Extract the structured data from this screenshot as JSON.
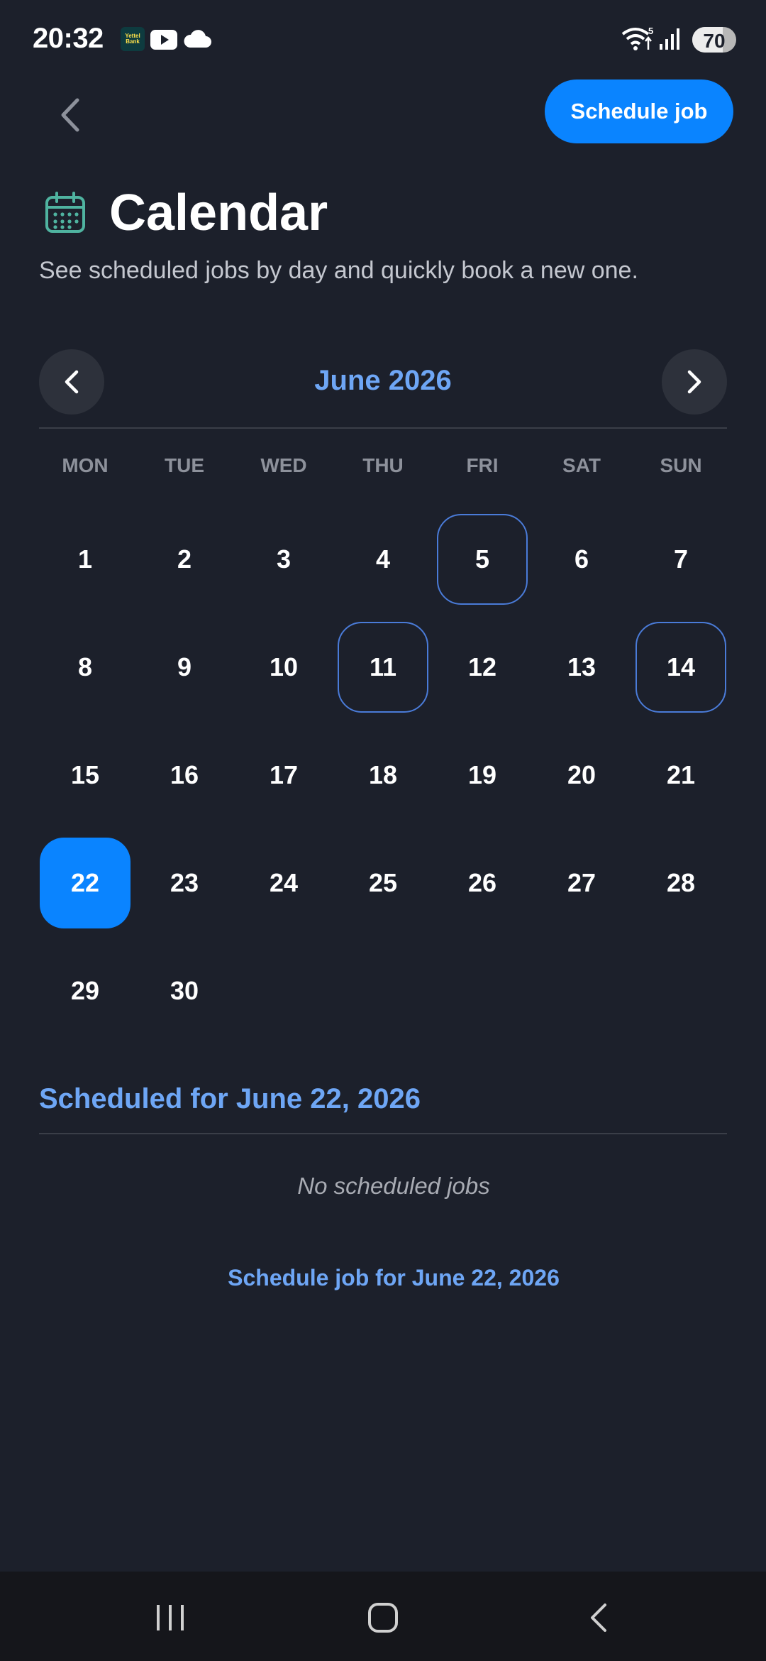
{
  "status_bar": {
    "time": "20:32",
    "bank_badge": "Yettel Bank",
    "wifi_badge": "5",
    "battery_level": "70",
    "icons": [
      "bank-app-icon",
      "youtube-icon",
      "cloud-icon",
      "wifi-icon",
      "signal-icon",
      "battery-icon"
    ]
  },
  "header": {
    "back_icon": "chevron-left-icon",
    "schedule_button": "Schedule job"
  },
  "page": {
    "title": "Calendar",
    "title_icon": "calendar-icon",
    "subtitle": "See scheduled jobs by day and quickly book a new one."
  },
  "month_nav": {
    "label": "June 2026",
    "prev_icon": "chevron-left-icon",
    "next_icon": "chevron-right-icon"
  },
  "calendar": {
    "weekdays": [
      "MON",
      "TUE",
      "WED",
      "THU",
      "FRI",
      "SAT",
      "SUN"
    ],
    "days": [
      "1",
      "2",
      "3",
      "4",
      "5",
      "6",
      "7",
      "8",
      "9",
      "10",
      "11",
      "12",
      "13",
      "14",
      "15",
      "16",
      "17",
      "18",
      "19",
      "20",
      "21",
      "22",
      "23",
      "24",
      "25",
      "26",
      "27",
      "28",
      "29",
      "30"
    ],
    "days_with_jobs": [
      "5",
      "11",
      "14"
    ],
    "selected_day": "22"
  },
  "scheduled": {
    "title": "Scheduled for June 22, 2026",
    "empty_text": "No scheduled jobs",
    "schedule_link": "Schedule job for June 22, 2026"
  },
  "nav_bar": {
    "icons": [
      "recent-apps-icon",
      "home-icon",
      "back-icon"
    ]
  },
  "colors": {
    "background": "#1c202b",
    "accent": "#0a84ff",
    "accent_text": "#6ea6f5",
    "job_outline": "#4a7bd8",
    "title_icon": "#4fb3a0"
  }
}
